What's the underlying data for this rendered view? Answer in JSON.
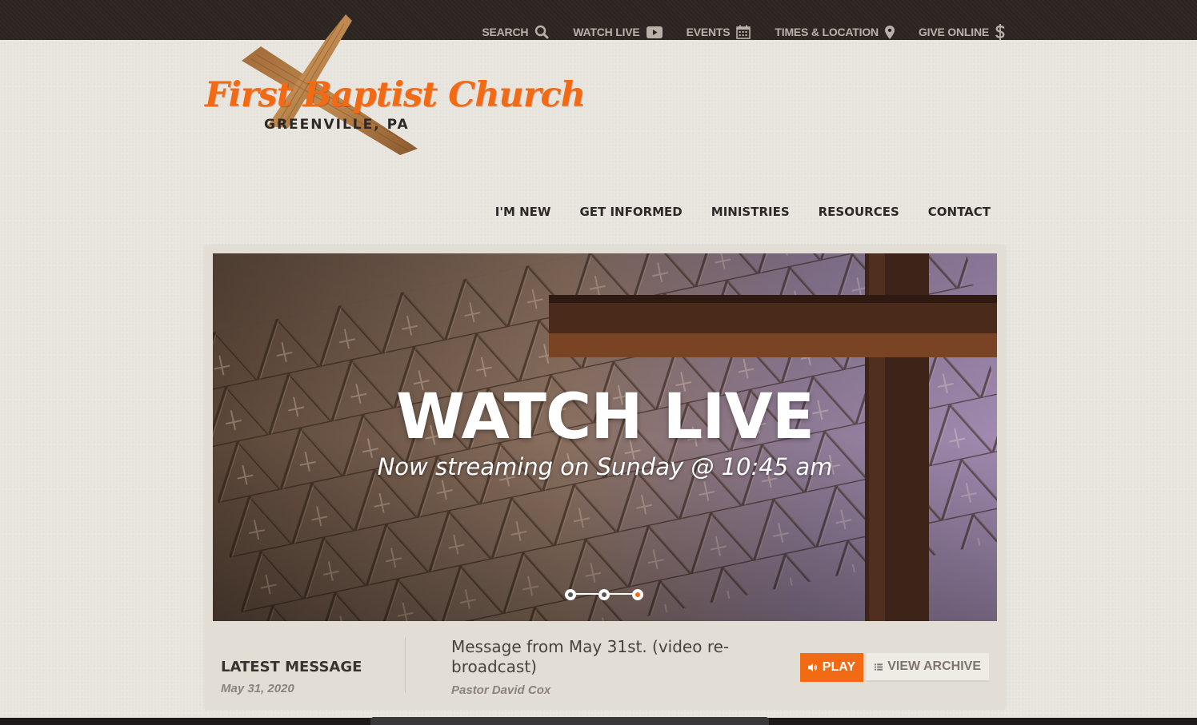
{
  "utility_nav": [
    {
      "label": "SEARCH",
      "icon": "search-icon"
    },
    {
      "label": "WATCH LIVE",
      "icon": "video-icon"
    },
    {
      "label": "EVENTS",
      "icon": "calendar-icon"
    },
    {
      "label": "TIMES & LOCATION",
      "icon": "map-pin-icon"
    },
    {
      "label": "GIVE ONLINE",
      "icon": "dollar-icon"
    }
  ],
  "logo": {
    "script": "First Baptist Church",
    "subtitle": "GREENVILLE, PA"
  },
  "main_nav": [
    "I'M NEW",
    "GET INFORMED",
    "MINISTRIES",
    "RESOURCES",
    "CONTACT"
  ],
  "hero": {
    "title": "WATCH LIVE",
    "subtitle": "Now streaming on Sunday @ 10:45 am",
    "slide_count": 3,
    "active_slide": 3
  },
  "latest": {
    "label": "LATEST MESSAGE",
    "date": "May 31, 2020",
    "title": "Message from May 31st. (video re-broadcast)",
    "speaker": "Pastor David Cox",
    "play_label": "PLAY",
    "archive_label": "VIEW ARCHIVE"
  },
  "colors": {
    "accent": "#f26a13",
    "topbar": "#2b2421",
    "background": "#e9e6e0",
    "text_dark": "#2d2826"
  }
}
